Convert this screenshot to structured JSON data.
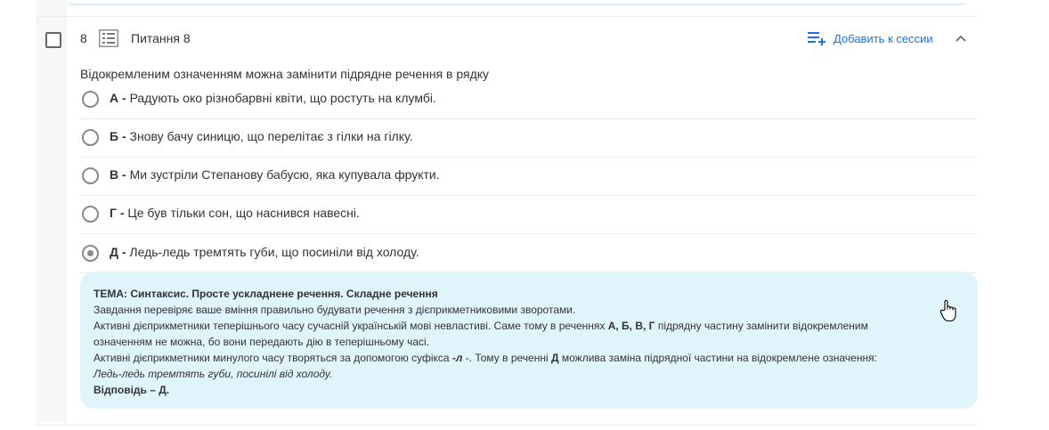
{
  "question": {
    "number": "8",
    "title": "Питання 8",
    "add_to_session": "Добавить к сессии",
    "text": "Відокремленим означенням можна замінити підрядне речення в рядку"
  },
  "options": [
    {
      "letter": "А -",
      "text": "Радують око різнобарвні квіти, що ростуть на клумбі.",
      "selected": false
    },
    {
      "letter": "Б -",
      "text": "Знову бачу синицю, що перелітає з гілки на гілку.",
      "selected": false
    },
    {
      "letter": "В -",
      "text": "Ми зустріли Степанову бабусю, яка купувала фрукти.",
      "selected": false
    },
    {
      "letter": "Г -",
      "text": "Це був тільки сон, що наснився навесні.",
      "selected": false
    },
    {
      "letter": "Д -",
      "text": "Ледь-ледь тремтять губи, що посиніли від холоду.",
      "selected": true
    }
  ],
  "explanation": {
    "topic": "ТЕМА: Синтаксис. Просте ускладнене речення. Складне речення",
    "line1": "Завдання перевіряє ваше вміння правильно будувати речення з дієприкметниковими зворотами.",
    "line2_a": "Активні дієприкметники теперішнього часу сучасній українській мові невластиві. Саме тому в реченнях ",
    "line2_b": "А, Б, В, Г",
    "line2_c": " підрядну частину замінити відокремленим",
    "line3": "означенням не можна, бо вони передають дію в теперішньому часі.",
    "line4_a": "Активні дієприкметники минулого часу творяться за допомогою суфікса ",
    "line4_b": "-л",
    "line4_c": " -. Тому в реченні ",
    "line4_d": "Д",
    "line4_e": " можлива заміна підрядної частини на відокремлене означення:",
    "line5": "Ледь-ледь тремтять губи, посинілі від холоду.",
    "answer": "Відповідь – Д."
  },
  "colors": {
    "accent": "#1a73e8",
    "explanation_bg": "#dff4fb",
    "radio": "#888888"
  }
}
